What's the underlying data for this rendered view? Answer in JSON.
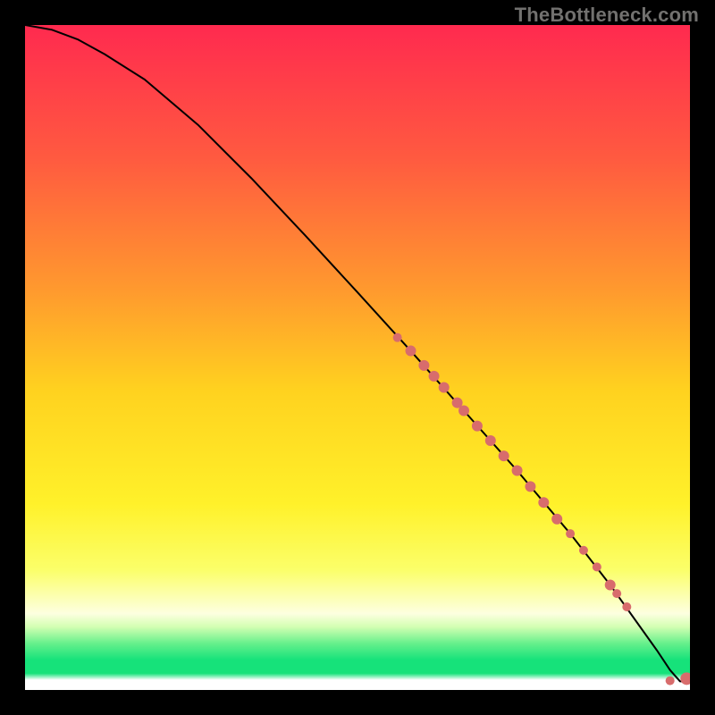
{
  "watermark_text": "TheBottleneck.com",
  "gradient": {
    "stops": [
      {
        "offset": 0.0,
        "color": "#ff2a4f"
      },
      {
        "offset": 0.2,
        "color": "#ff5a40"
      },
      {
        "offset": 0.4,
        "color": "#ff9a2e"
      },
      {
        "offset": 0.55,
        "color": "#ffd21f"
      },
      {
        "offset": 0.72,
        "color": "#fff12a"
      },
      {
        "offset": 0.82,
        "color": "#fbff6a"
      },
      {
        "offset": 0.885,
        "color": "#fdffe0"
      },
      {
        "offset": 0.905,
        "color": "#d3ffb2"
      },
      {
        "offset": 0.93,
        "color": "#66f08c"
      },
      {
        "offset": 0.955,
        "color": "#16e27a"
      },
      {
        "offset": 0.975,
        "color": "#16e27a"
      },
      {
        "offset": 0.985,
        "color": "#ffffff"
      },
      {
        "offset": 1.0,
        "color": "#ffffff"
      }
    ]
  },
  "curve_color": "#000000",
  "curve_stroke_width": 2.0,
  "dot_color": "#d86c6c",
  "chart_data": {
    "type": "line",
    "title": "",
    "xlabel": "",
    "ylabel": "",
    "xlim": [
      0,
      100
    ],
    "ylim": [
      0,
      100
    ],
    "curve": {
      "x": [
        0,
        4,
        8,
        12,
        18,
        26,
        34,
        42,
        50,
        58,
        66,
        74,
        82,
        88,
        92,
        95,
        97,
        98.5,
        100
      ],
      "y": [
        100,
        99.3,
        97.8,
        95.6,
        91.8,
        85.0,
        77.0,
        68.5,
        59.8,
        51.0,
        42.0,
        33.0,
        23.5,
        15.8,
        10.2,
        6.0,
        3.0,
        1.3,
        1.3
      ]
    },
    "highlight_points": {
      "note": "approximate positions of the thick pinkish-red dot cluster along the lower portion of the curve, plus the white-band end dots",
      "x": [
        56,
        58,
        60,
        61.5,
        63,
        65,
        66,
        68,
        70,
        72,
        74,
        76,
        78,
        80,
        82,
        84,
        86,
        88,
        89,
        90.5,
        97,
        99.5
      ],
      "y": [
        53.0,
        51.0,
        48.8,
        47.2,
        45.5,
        43.2,
        42.0,
        39.7,
        37.5,
        35.2,
        33.0,
        30.6,
        28.2,
        25.7,
        23.5,
        21.0,
        18.5,
        15.8,
        14.5,
        12.5,
        1.4,
        1.7
      ],
      "r": [
        5,
        6,
        6,
        6,
        6,
        6,
        6,
        6,
        6,
        6,
        6,
        6,
        6,
        6,
        5,
        5,
        5,
        6,
        5,
        5,
        5,
        7
      ]
    }
  }
}
